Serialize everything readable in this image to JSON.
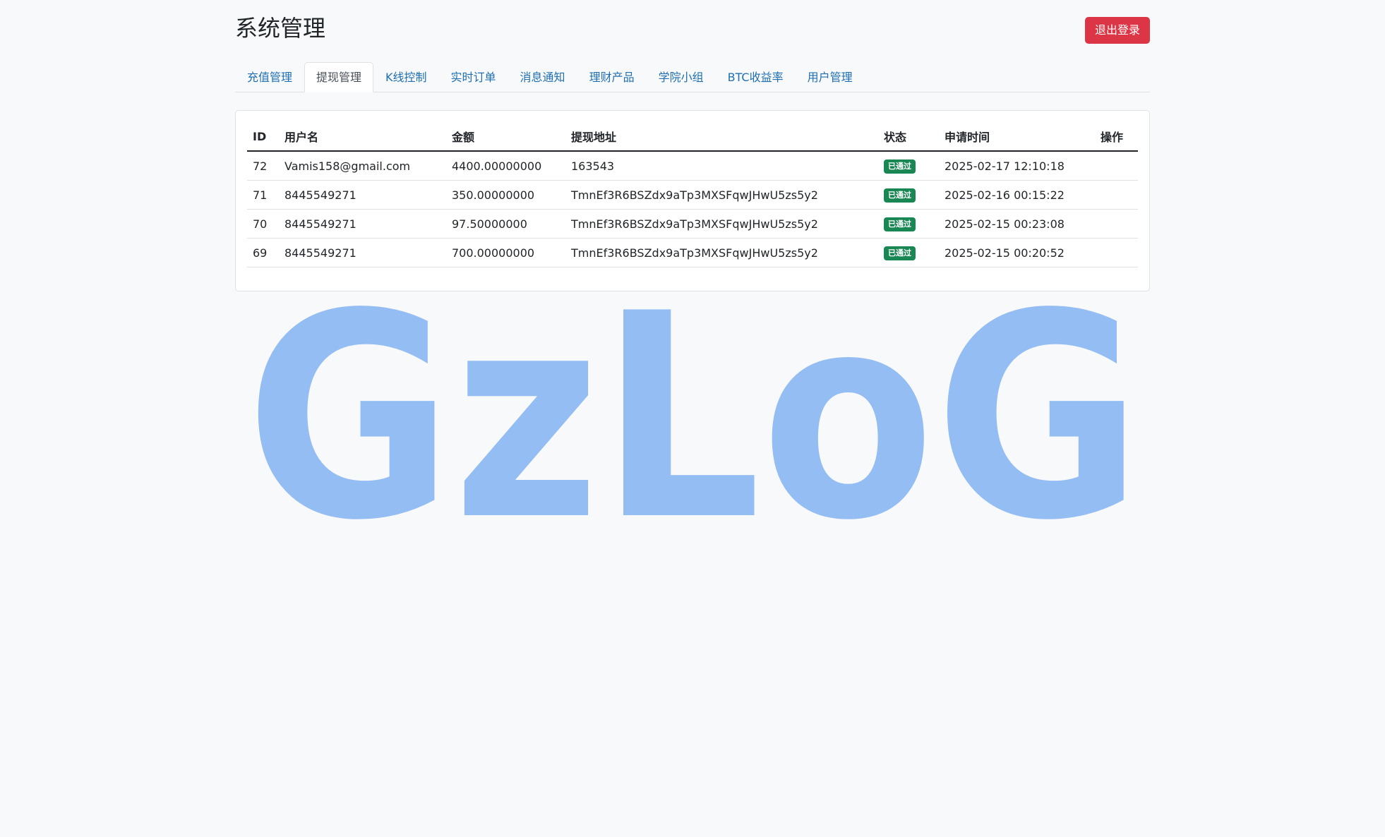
{
  "header": {
    "title": "系统管理",
    "logout_label": "退出登录"
  },
  "tabs": [
    {
      "label": "充值管理",
      "active": false
    },
    {
      "label": "提现管理",
      "active": true
    },
    {
      "label": "K线控制",
      "active": false
    },
    {
      "label": "实时订单",
      "active": false
    },
    {
      "label": "消息通知",
      "active": false
    },
    {
      "label": "理财产品",
      "active": false
    },
    {
      "label": "学院小组",
      "active": false
    },
    {
      "label": "BTC收益率",
      "active": false
    },
    {
      "label": "用户管理",
      "active": false
    }
  ],
  "table": {
    "columns": [
      "ID",
      "用户名",
      "金额",
      "提现地址",
      "状态",
      "申请时间",
      "操作"
    ],
    "rows": [
      {
        "id": "72",
        "username": "Vamis158@gmail.com",
        "amount": "4400.00000000",
        "address": "163543",
        "status": "已通过",
        "time": "2025-02-17 12:10:18",
        "action": ""
      },
      {
        "id": "71",
        "username": "8445549271",
        "amount": "350.00000000",
        "address": "TmnEf3R6BSZdx9aTp3MXSFqwJHwU5zs5y2",
        "status": "已通过",
        "time": "2025-02-16 00:15:22",
        "action": ""
      },
      {
        "id": "70",
        "username": "8445549271",
        "amount": "97.50000000",
        "address": "TmnEf3R6BSZdx9aTp3MXSFqwJHwU5zs5y2",
        "status": "已通过",
        "time": "2025-02-15 00:23:08",
        "action": ""
      },
      {
        "id": "69",
        "username": "8445549271",
        "amount": "700.00000000",
        "address": "TmnEf3R6BSZdx9aTp3MXSFqwJHwU5zs5y2",
        "status": "已通过",
        "time": "2025-02-15 00:20:52",
        "action": ""
      }
    ]
  },
  "watermark": {
    "text": "GzLoG",
    "color": "#94bdf3"
  },
  "colors": {
    "danger": "#dc3545",
    "success": "#198754",
    "link": "#1f6fb2"
  }
}
